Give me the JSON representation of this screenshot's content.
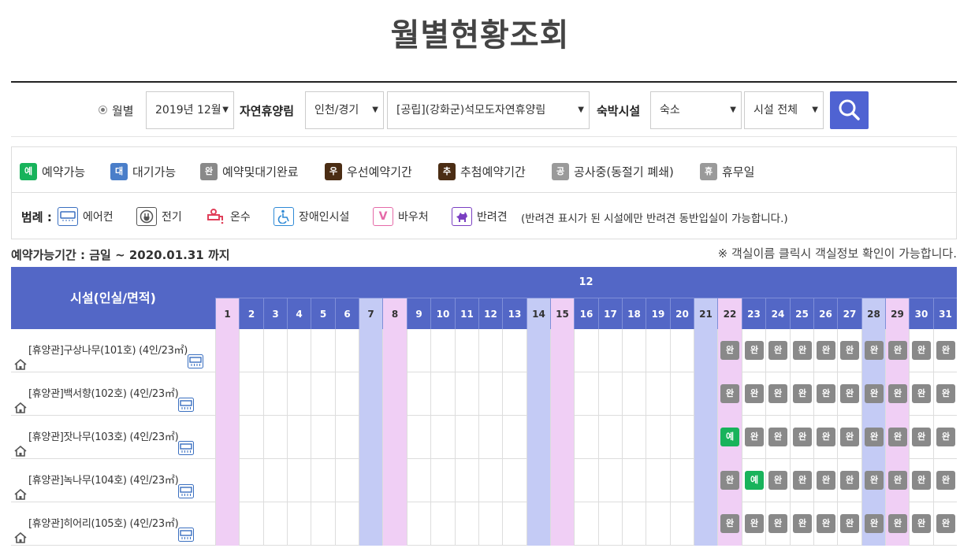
{
  "page_title": "월별현황조회",
  "filters": {
    "radio_label": "월별",
    "month_value": "2019년 12월",
    "forest_label": "자연휴양림",
    "region_value": "인천/경기",
    "forest_value": "[공립](강화군)석모도자연휴양림",
    "lodging_label": "숙박시설",
    "lodging_type_value": "숙소",
    "facility_value": "시설 전체"
  },
  "status_legend": [
    {
      "symbol": "예",
      "label": "예약가능",
      "color": "#18b35b"
    },
    {
      "symbol": "대",
      "label": "대기가능",
      "color": "#4a7ec9"
    },
    {
      "symbol": "완",
      "label": "예약및대기완료",
      "color": "#898989"
    },
    {
      "symbol": "우",
      "label": "우선예약기간",
      "color": "#4b2d14"
    },
    {
      "symbol": "추",
      "label": "추첨예약기간",
      "color": "#4b2d14"
    },
    {
      "symbol": "공",
      "label": "공사중(동절기 폐쇄)",
      "color": "#9a9a9a"
    },
    {
      "symbol": "휴",
      "label": "휴무일",
      "color": "#9a9a9a"
    }
  ],
  "icon_legend": {
    "title": "범례 :",
    "items": [
      {
        "icon": "air-conditioner-icon",
        "label": "에어컨"
      },
      {
        "icon": "electric-plug-icon",
        "label": "전기"
      },
      {
        "icon": "hot-water-icon",
        "label": "온수"
      },
      {
        "icon": "wheelchair-icon",
        "label": "장애인시설"
      },
      {
        "icon": "voucher-icon",
        "glyph": "V",
        "label": "바우처"
      },
      {
        "icon": "pet-dog-icon",
        "label": "반려견"
      }
    ],
    "pet_note": "(반려견 표시가 된 시설에만 반려견 동반입실이 가능합니다.)"
  },
  "period_text": "예약가능기간 : 금일 ~ 2020.01.31 까지",
  "room_note": "※ 객실이름 클릭시 객실정보 확인이 가능합니다.",
  "calendar": {
    "facility_header": "시설(인실/면적)",
    "month": "12",
    "days": [
      "1",
      "2",
      "3",
      "4",
      "5",
      "6",
      "7",
      "8",
      "9",
      "10",
      "11",
      "12",
      "13",
      "14",
      "15",
      "16",
      "17",
      "18",
      "19",
      "20",
      "21",
      "22",
      "23",
      "24",
      "25",
      "26",
      "27",
      "28",
      "29",
      "30",
      "31"
    ],
    "saturday_days": [
      7,
      14,
      21,
      28
    ],
    "holiday_days": [
      1,
      8,
      15,
      22,
      29
    ],
    "rooms": [
      {
        "name": "[휴양관]구상나무(101호) (4인/23㎡)",
        "status": {
          "22": "완",
          "23": "완",
          "24": "완",
          "25": "완",
          "26": "완",
          "27": "완",
          "28": "완",
          "29": "완",
          "30": "완",
          "31": "완"
        }
      },
      {
        "name": "[휴양관]백서향(102호) (4인/23㎡)",
        "status": {
          "22": "완",
          "23": "완",
          "24": "완",
          "25": "완",
          "26": "완",
          "27": "완",
          "28": "완",
          "29": "완",
          "30": "완",
          "31": "완"
        }
      },
      {
        "name": "[휴양관]잣나무(103호) (4인/23㎡)",
        "status": {
          "22": "예",
          "23": "완",
          "24": "완",
          "25": "완",
          "26": "완",
          "27": "완",
          "28": "완",
          "29": "완",
          "30": "완",
          "31": "완"
        }
      },
      {
        "name": "[휴양관]녹나무(104호) (4인/23㎡)",
        "status": {
          "22": "완",
          "23": "예",
          "24": "완",
          "25": "완",
          "26": "완",
          "27": "완",
          "28": "완",
          "29": "완",
          "30": "완",
          "31": "완"
        }
      },
      {
        "name": "[휴양관]히어리(105호) (4인/23㎡)",
        "status": {
          "22": "완",
          "23": "완",
          "24": "완",
          "25": "완",
          "26": "완",
          "27": "완",
          "28": "완",
          "29": "완",
          "30": "완",
          "31": "완"
        }
      }
    ]
  }
}
